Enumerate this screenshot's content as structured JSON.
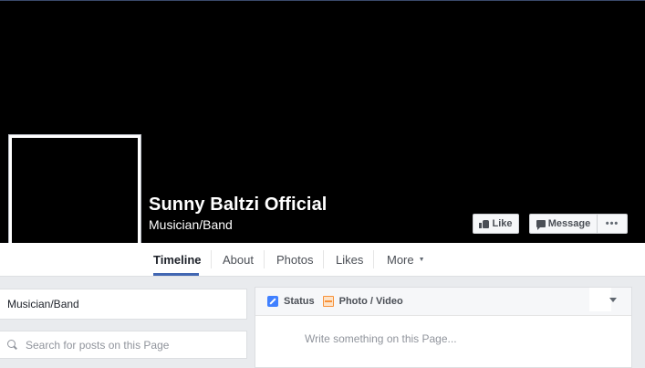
{
  "page": {
    "name": "Sunny Baltzi Official",
    "category": "Musician/Band"
  },
  "actions": {
    "like_label": "Like",
    "message_label": "Message",
    "more_label": "•••"
  },
  "nav": {
    "tabs": [
      {
        "label": "Timeline",
        "active": true
      },
      {
        "label": "About"
      },
      {
        "label": "Photos"
      },
      {
        "label": "Likes"
      },
      {
        "label": "More"
      }
    ],
    "more_caret": "▼"
  },
  "sidebar": {
    "category": "Musician/Band",
    "search_placeholder": "Search for posts on this Page"
  },
  "composer": {
    "status_label": "Status",
    "photo_label": "Photo / Video",
    "input_placeholder": "Write something on this Page..."
  },
  "icons": {
    "like": "thumbs-up-icon",
    "message": "message-icon",
    "search": "search-icon",
    "status": "pencil-icon",
    "photo": "photo-icon"
  },
  "colors": {
    "accent": "#4267b2",
    "status_blue": "#4080ff",
    "photo_orange": "#f7923b",
    "cover": "#000000"
  }
}
